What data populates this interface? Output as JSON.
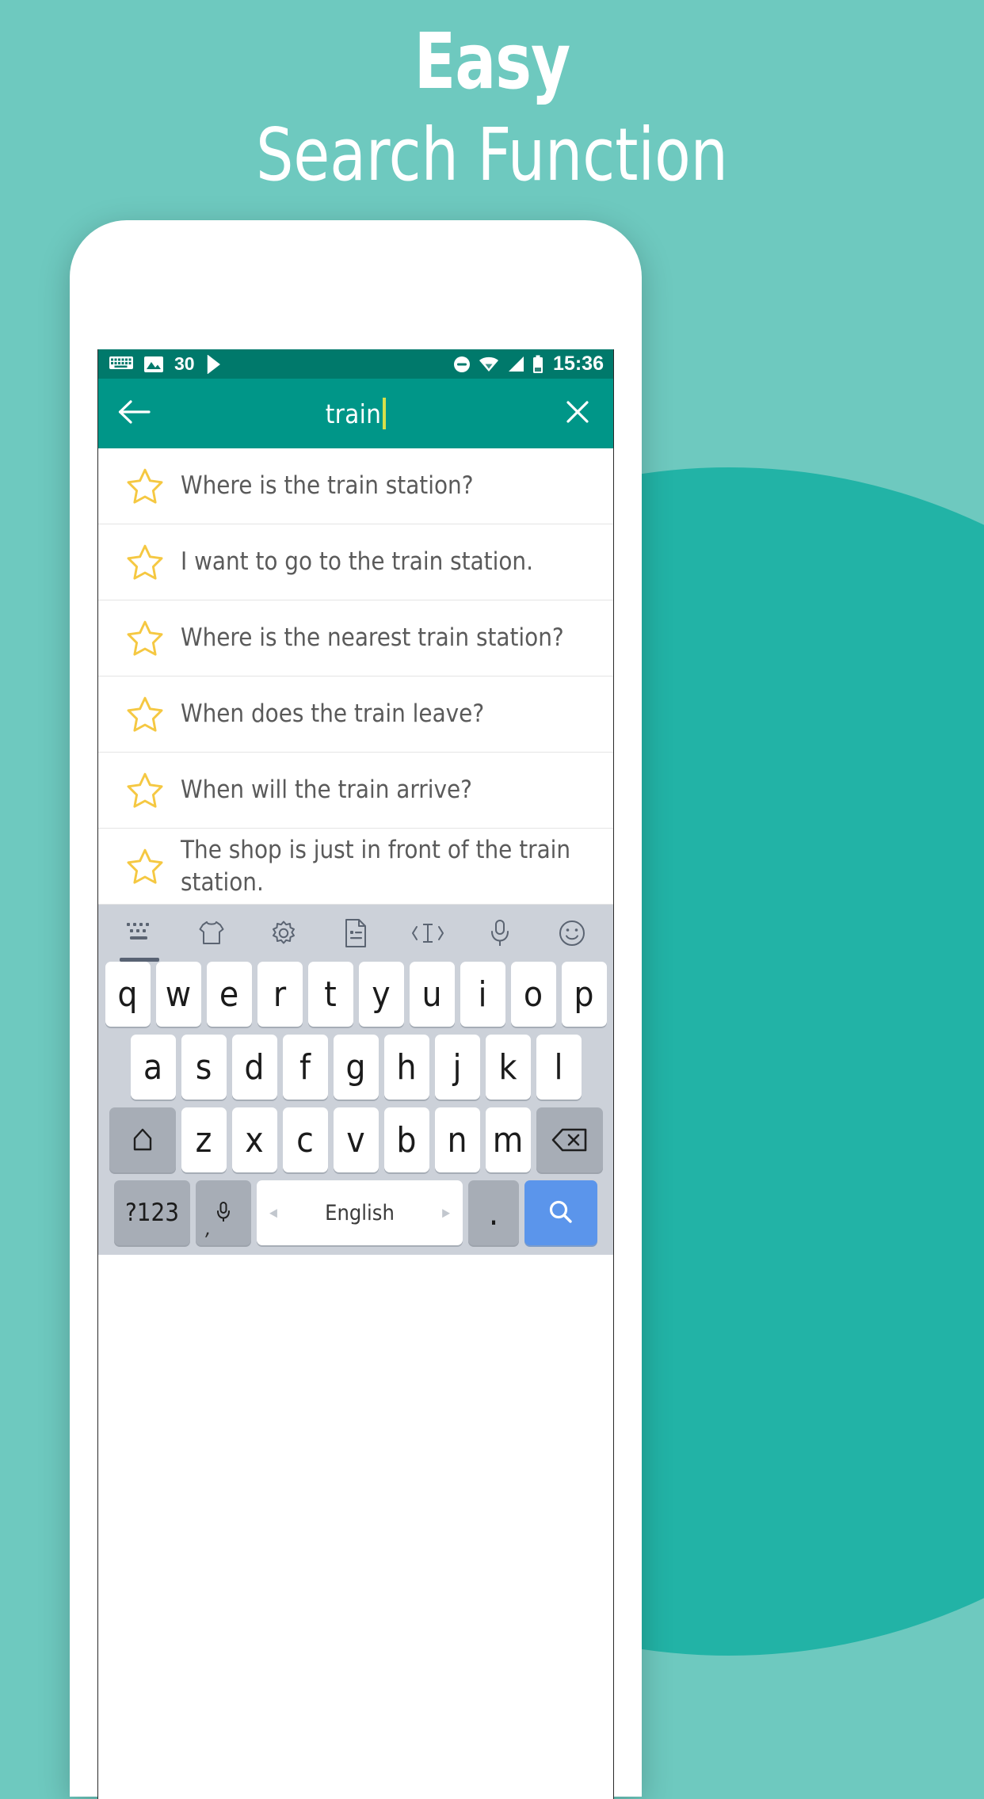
{
  "hero": {
    "line1": "Easy",
    "line2": "Search Function",
    "bg_color": "#6ec9bf",
    "accent_circle_color": "#22b3a6"
  },
  "statusbar": {
    "bg_color": "#00796b",
    "notification_count": "30",
    "clock": "15:36",
    "left_icons": [
      "keyboard-icon",
      "image-icon",
      "play-store-icon"
    ],
    "right_icons": [
      "do-not-disturb-icon",
      "wifi-icon",
      "signal-icon",
      "battery-icon"
    ]
  },
  "appbar": {
    "bg_color": "#009688",
    "back_icon": "arrow-left-icon",
    "query": "train",
    "placeholder": "Search",
    "clear_icon": "close-icon"
  },
  "results": [
    {
      "star": "star-outline-icon",
      "text": "Where is the train station?"
    },
    {
      "star": "star-outline-icon",
      "text": "I want to go to the train station."
    },
    {
      "star": "star-outline-icon",
      "text": "Where is the nearest train station?"
    },
    {
      "star": "star-outline-icon",
      "text": "When does the train leave?"
    },
    {
      "star": "star-outline-icon",
      "text": "When will the train arrive?"
    },
    {
      "star": "star-outline-icon",
      "text": "The shop is just in front of the train station."
    }
  ],
  "keyboard": {
    "bg_color": "#ccd1d9",
    "toolbar": [
      {
        "name": "keyboard-icon",
        "active": true
      },
      {
        "name": "theme-shirt-icon",
        "active": false
      },
      {
        "name": "gear-icon",
        "active": false
      },
      {
        "name": "clipboard-icon",
        "active": false
      },
      {
        "name": "cursor-move-icon",
        "active": false
      },
      {
        "name": "microphone-icon",
        "active": false
      },
      {
        "name": "emoji-icon",
        "active": false
      }
    ],
    "row1": [
      "q",
      "w",
      "e",
      "r",
      "t",
      "y",
      "u",
      "i",
      "o",
      "p"
    ],
    "row2": [
      "a",
      "s",
      "d",
      "f",
      "g",
      "h",
      "j",
      "k",
      "l"
    ],
    "row3": [
      "z",
      "x",
      "c",
      "v",
      "b",
      "n",
      "m"
    ],
    "shift_label": "shift-icon",
    "backspace_label": "backspace-icon",
    "symbols_label": "?123",
    "mic_label": "microphone-icon",
    "comma_label": ",",
    "space_label": "English",
    "space_arrow_left": "◂",
    "space_arrow_right": "▸",
    "period_label": ".",
    "enter_label": "search-icon",
    "enter_color": "#5b95eb"
  }
}
